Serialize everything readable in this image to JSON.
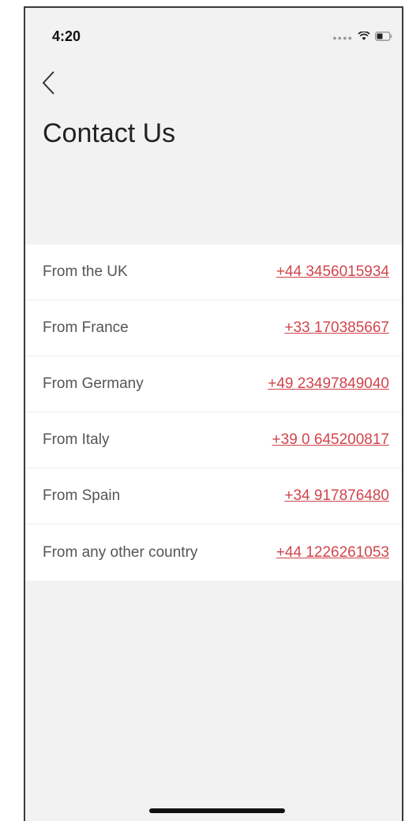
{
  "status_bar": {
    "time": "4:20",
    "icons": [
      "signal-dots-icon",
      "wifi-icon",
      "battery-icon"
    ]
  },
  "header": {
    "back_icon": "chevron-left-icon",
    "title": "Contact Us"
  },
  "contacts": [
    {
      "label": "From the UK",
      "phone": "+44 3456015934"
    },
    {
      "label": "From France",
      "phone": "+33 170385667"
    },
    {
      "label": "From Germany",
      "phone": "+49 23497849040"
    },
    {
      "label": "From Italy",
      "phone": "+39 0 645200817"
    },
    {
      "label": "From Spain",
      "phone": "+34 917876480"
    },
    {
      "label": "From any other country",
      "phone": "+44 1226261053"
    }
  ],
  "colors": {
    "link": "#d0454c",
    "background": "#f2f2f2",
    "row_background": "#ffffff"
  }
}
